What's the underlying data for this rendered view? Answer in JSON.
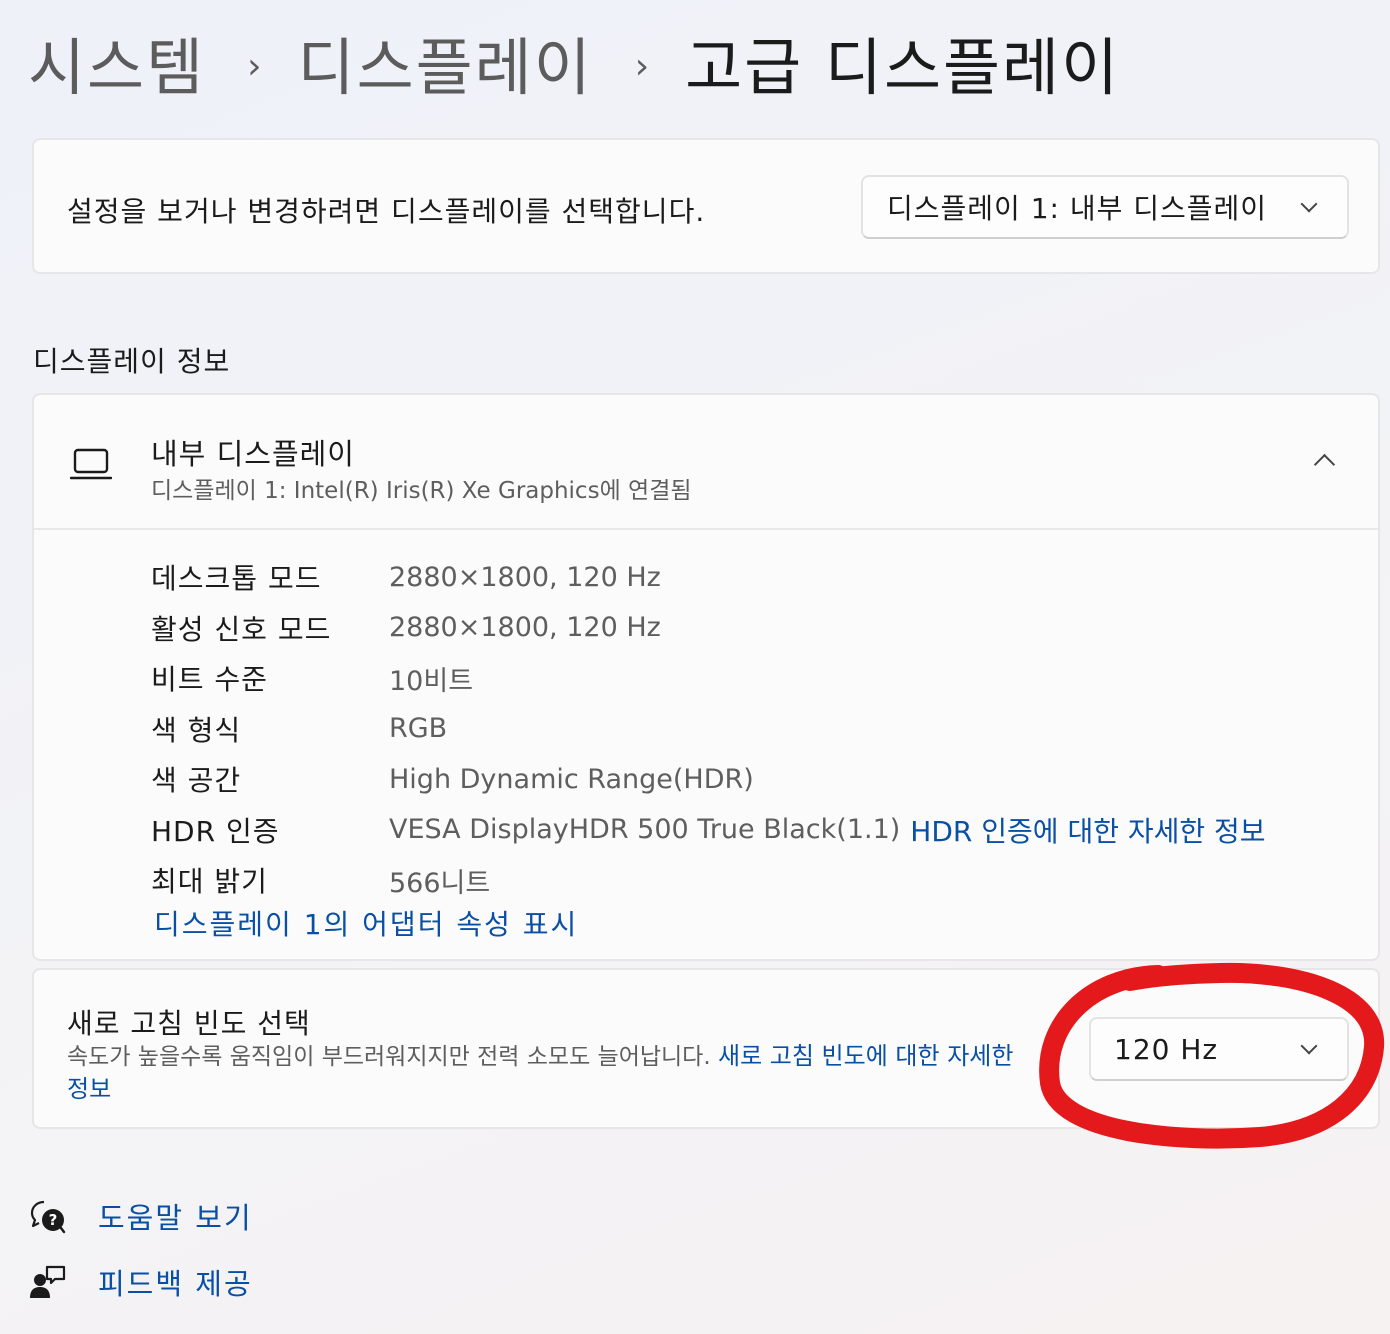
{
  "breadcrumb": {
    "items": [
      "시스템",
      "디스플레이",
      "고급 디스플레이"
    ],
    "separator": "›"
  },
  "display_select": {
    "description": "설정을 보거나 변경하려면 디스플레이를 선택합니다.",
    "selected": "디스플레이 1: 내부 디스플레이"
  },
  "display_info": {
    "section_title": "디스플레이 정보",
    "title": "내부 디스플레이",
    "subtitle": "디스플레이 1: Intel(R) Iris(R) Xe Graphics에 연결됨",
    "specs": [
      {
        "label": "데스크톱 모드",
        "value": "2880×1800, 120 Hz"
      },
      {
        "label": "활성 신호 모드",
        "value": "2880×1800, 120 Hz"
      },
      {
        "label": "비트 수준",
        "value": "10비트"
      },
      {
        "label": "색 형식",
        "value": "RGB"
      },
      {
        "label": "색 공간",
        "value": "High Dynamic Range(HDR)"
      },
      {
        "label": "HDR 인증",
        "value": "VESA DisplayHDR 500 True Black(1.1)",
        "link": "HDR 인증에 대한 자세한 정보"
      },
      {
        "label": "최대 밝기",
        "value": "566니트"
      }
    ],
    "adapter_link": "디스플레이 1의 어댑터 속성 표시"
  },
  "refresh_rate": {
    "title": "새로 고침 빈도 선택",
    "description": "속도가 높을수록 움직임이 부드러워지지만 전력 소모도 늘어납니다.",
    "link": "새로 고침 빈도에 대한 자세한 정보",
    "selected": "120 Hz"
  },
  "footer": {
    "help": "도움말 보기",
    "feedback": "피드백 제공"
  },
  "colors": {
    "link": "#0a4fa6",
    "annotation": "#e3191c"
  },
  "icons": {
    "display": "laptop-icon",
    "expand": "chevron-up-icon",
    "dropdown": "chevron-down-icon",
    "help": "help-icon",
    "feedback": "feedback-icon"
  }
}
